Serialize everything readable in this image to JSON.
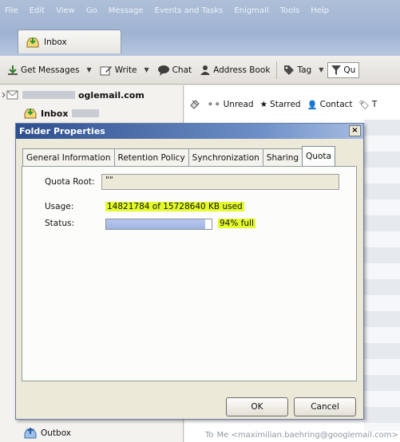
{
  "menu": [
    "File",
    "Edit",
    "View",
    "Go",
    "Message",
    "Events and Tasks",
    "Enigmail",
    "Tools",
    "Help"
  ],
  "tab": {
    "label": "Inbox"
  },
  "toolbar": {
    "get_messages": "Get Messages",
    "write": "Write",
    "chat": "Chat",
    "address_book": "Address Book",
    "tag": "Tag",
    "quick_filter": "Qu"
  },
  "folder_pane": {
    "account": "oglemail.com",
    "inbox": "Inbox",
    "outbox": "Outbox"
  },
  "filter_bar": {
    "unread": "Unread",
    "starred": "Starred",
    "contact": "Contact",
    "tags": "T"
  },
  "status_line": {
    "to_prefix": "To",
    "recipient": "Me <maximilian.baehring@googlemail.com>"
  },
  "dialog": {
    "title": "Folder Properties",
    "close": "×",
    "tabs": [
      "General Information",
      "Retention Policy",
      "Synchronization",
      "Sharing",
      "Quota"
    ],
    "active_tab": "Quota",
    "quota_root_label": "Quota Root:",
    "quota_root_value": "\"\"",
    "usage_label": "Usage:",
    "usage_value": "14821784 of 15728640 KB used",
    "status_label": "Status:",
    "status_value": "94% full",
    "usage_fraction": 0.94,
    "ok": "OK",
    "cancel": "Cancel"
  },
  "colors": {
    "highlight": "#e4fb2c",
    "progress_fill": "#a9bde8",
    "title_bar": "#2e4f8e"
  }
}
